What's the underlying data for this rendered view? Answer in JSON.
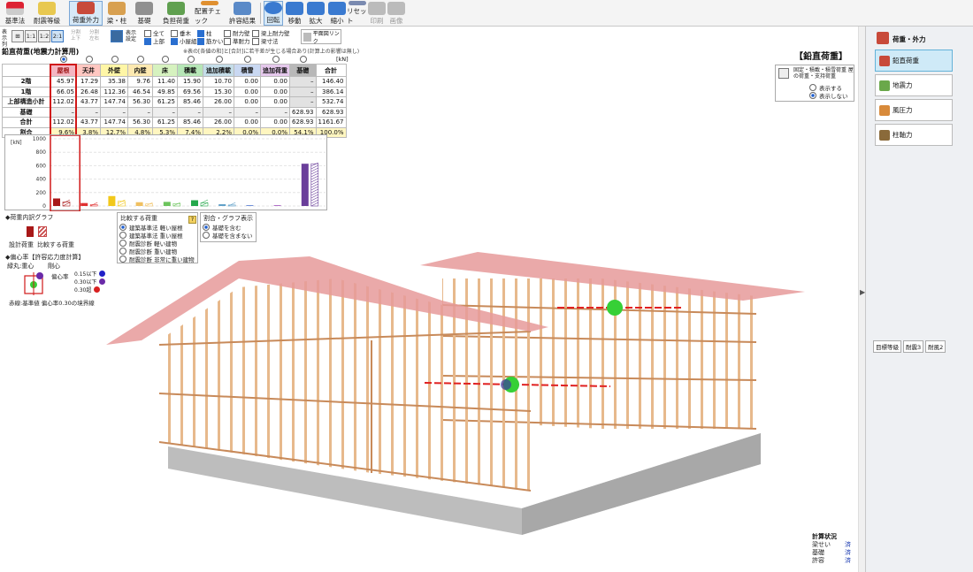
{
  "toolbar": {
    "items": [
      {
        "label": "基準法"
      },
      {
        "label": "耐震等級"
      },
      {
        "label": "荷重外力"
      },
      {
        "label": "梁・柱"
      },
      {
        "label": "基礎"
      },
      {
        "label": "負担荷重"
      },
      {
        "label": "配置チェック"
      },
      {
        "label": "許容結果"
      },
      {
        "label": "回転"
      },
      {
        "label": "移動"
      },
      {
        "label": "拡大"
      },
      {
        "label": "縮小"
      },
      {
        "label": "リセット"
      },
      {
        "label": "印刷"
      },
      {
        "label": "画像"
      }
    ]
  },
  "toolbar2": {
    "display_label": "表示列",
    "buttons": [
      "1:1",
      "1:2",
      "2:1"
    ],
    "split_top": "分割上下",
    "split_left": "分割左右",
    "show_settings": "表示設定",
    "cb_all": "全て",
    "cb_upper": "上部",
    "cb_taruki": "垂木",
    "cb_koyagumi": "小屋組",
    "cb_pillar": "柱",
    "cb_sujikai": "筋かい",
    "cb_taiwall": "耐力壁",
    "cb_junmi": "準耐力",
    "cb_beamwall": "梁上耐力壁",
    "cb_beamsize": "梁寸法",
    "plan_link": "平面図リンク"
  },
  "table": {
    "title": "鉛直荷重(地震力計算用)",
    "note": "※表の[各値の和]と[合計]に若干差が生じる場合あり(計算上の影響は無し)",
    "unit": "[kN]",
    "columns": [
      "屋根",
      "天井",
      "外壁",
      "内壁",
      "床",
      "積載",
      "追加積載",
      "積雪",
      "追加荷重",
      "基礎",
      "合計"
    ],
    "col_colors": [
      "#f4b6c2",
      "#ffc7c1",
      "#fff6a6",
      "#fde9b0",
      "#d6f2bf",
      "#b6e6b6",
      "#c4dde8",
      "#c9d8f2",
      "#e5c8ec",
      "#b8b8b8",
      "#ffffff"
    ],
    "rows": [
      {
        "label": "2階",
        "values": [
          "45.97",
          "17.29",
          "35.38",
          "9.76",
          "11.40",
          "15.90",
          "10.70",
          "0.00",
          "0.00",
          "–",
          "146.40"
        ]
      },
      {
        "label": "1階",
        "values": [
          "66.05",
          "26.48",
          "112.36",
          "46.54",
          "49.85",
          "69.56",
          "15.30",
          "0.00",
          "0.00",
          "–",
          "386.14"
        ]
      },
      {
        "label": "上部構造小計",
        "values": [
          "112.02",
          "43.77",
          "147.74",
          "56.30",
          "61.25",
          "85.46",
          "26.00",
          "0.00",
          "0.00",
          "–",
          "532.74"
        ]
      },
      {
        "label": "基礎",
        "values": [
          "–",
          "–",
          "–",
          "–",
          "–",
          "–",
          "–",
          "–",
          "–",
          "628.93",
          "628.93"
        ]
      },
      {
        "label": "合計",
        "values": [
          "112.02",
          "43.77",
          "147.74",
          "56.30",
          "61.25",
          "85.46",
          "26.00",
          "0.00",
          "0.00",
          "628.93",
          "1161.67"
        ]
      },
      {
        "label": "割合",
        "values": [
          "9.6%",
          "3.8%",
          "12.7%",
          "4.8%",
          "5.3%",
          "7.4%",
          "2.2%",
          "0.0%",
          "0.0%",
          "54.1%",
          "100.0%"
        ]
      }
    ]
  },
  "chart_data": {
    "type": "bar",
    "ylabel": "[kN]",
    "ylim": [
      0,
      1000
    ],
    "yticks": [
      "1000",
      "800",
      "600",
      "400",
      "200",
      "0"
    ],
    "categories": [
      "屋根",
      "天井",
      "外壁",
      "内壁",
      "床",
      "積載",
      "追加積載",
      "積雪",
      "追加荷重",
      "基礎"
    ],
    "series": [
      {
        "name": "設計荷重",
        "values": [
          112.02,
          43.77,
          147.74,
          56.3,
          61.25,
          85.46,
          26.0,
          0,
          0,
          628.93
        ]
      },
      {
        "name": "比較する荷重",
        "values": [
          60,
          20,
          70,
          30,
          35,
          45,
          15,
          0,
          0,
          628.93
        ]
      }
    ],
    "colors": [
      "#a81818",
      "#e03030",
      "#f2c81a",
      "#f0c060",
      "#6cc45c",
      "#24a84c",
      "#60a0c8",
      "#7090d8",
      "#b070c8",
      "#6a3e9a"
    ]
  },
  "legend": {
    "breakdown": "◆荷重内訳グラフ",
    "design": "設計荷重",
    "compare": "比較する荷重",
    "eccentric": "◆偏心率【許容応力度計算】",
    "green": "緑丸:重心",
    "rigid": "剛心",
    "ecc_label": "偏心率",
    "ecc_items": [
      "0.15以下",
      "0.30以下",
      "0.30超"
    ],
    "ecc_colors": [
      "#2020c8",
      "#6a2aa8",
      "#d82020"
    ],
    "redline": "赤線:基準値 偏心率0.30の境界線"
  },
  "compare_box": {
    "title": "比較する荷重",
    "options": [
      "建築基準法 軽い屋根",
      "建築基準法 重い屋根",
      "耐震診断 軽い建物",
      "耐震診断 重い建物",
      "耐震診断 非常に重い建物"
    ]
  },
  "ratio_box": {
    "title": "割合・グラフ表示",
    "options": [
      "基礎を含む",
      "基礎を含まない"
    ]
  },
  "view_label": "【鉛直荷重】",
  "fixed_box": {
    "title": "固定・積載・積雪荷重 屋の荷重・支持荷重",
    "options": [
      "表示する",
      "表示しない"
    ]
  },
  "status": {
    "title": "計算状況",
    "items": [
      {
        "label": "梁せい",
        "value": "済"
      },
      {
        "label": "基礎",
        "value": "済"
      },
      {
        "label": "許容",
        "value": "済"
      }
    ]
  },
  "right_panel": {
    "header": "荷重・外力",
    "buttons": [
      "鉛直荷重",
      "地震力",
      "風圧力",
      "柱軸力"
    ],
    "tabs": [
      "目標等級",
      "耐震3",
      "耐風2"
    ]
  }
}
